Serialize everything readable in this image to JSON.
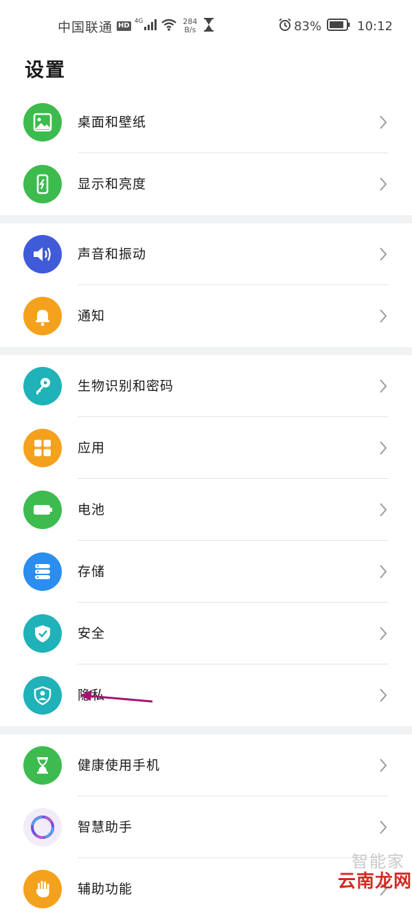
{
  "status_bar": {
    "carrier": "中国联通",
    "hd_badge": "HD",
    "network": "4G",
    "speed_value": "284",
    "speed_unit": "B/s",
    "battery_percent": "83%",
    "time": "10:12",
    "icons": [
      "signal-icon",
      "wifi-icon",
      "hourglass-icon",
      "alarm-icon",
      "battery-icon"
    ]
  },
  "page": {
    "title": "设置"
  },
  "groups": [
    {
      "items": [
        {
          "label": "桌面和壁纸",
          "icon": "wallpaper-icon",
          "color": "#3dbb4e"
        },
        {
          "label": "显示和亮度",
          "icon": "display-brightness-icon",
          "color": "#3dbb4e"
        }
      ]
    },
    {
      "items": [
        {
          "label": "声音和振动",
          "icon": "speaker-icon",
          "color": "#3f5bd8"
        },
        {
          "label": "通知",
          "icon": "bell-icon",
          "color": "#f4a11e"
        }
      ]
    },
    {
      "items": [
        {
          "label": "生物识别和密码",
          "icon": "key-icon",
          "color": "#1fb2b8"
        },
        {
          "label": "应用",
          "icon": "apps-grid-icon",
          "color": "#f4a11e"
        },
        {
          "label": "电池",
          "icon": "battery-icon",
          "color": "#3dbb4e"
        },
        {
          "label": "存储",
          "icon": "storage-icon",
          "color": "#2a8ef0"
        },
        {
          "label": "安全",
          "icon": "shield-check-icon",
          "color": "#1fb2b8"
        },
        {
          "label": "隐私",
          "icon": "privacy-icon",
          "color": "#1fb2b8"
        }
      ]
    },
    {
      "items": [
        {
          "label": "健康使用手机",
          "icon": "hourglass-icon",
          "color": "#3dbb4e"
        },
        {
          "label": "智慧助手",
          "icon": "assistant-ring-icon",
          "color": "#f1ecf7"
        },
        {
          "label": "辅助功能",
          "icon": "hand-icon",
          "color": "#f4a11e"
        }
      ]
    }
  ],
  "watermark": {
    "line1": "智能家",
    "line2": "云南龙网"
  }
}
